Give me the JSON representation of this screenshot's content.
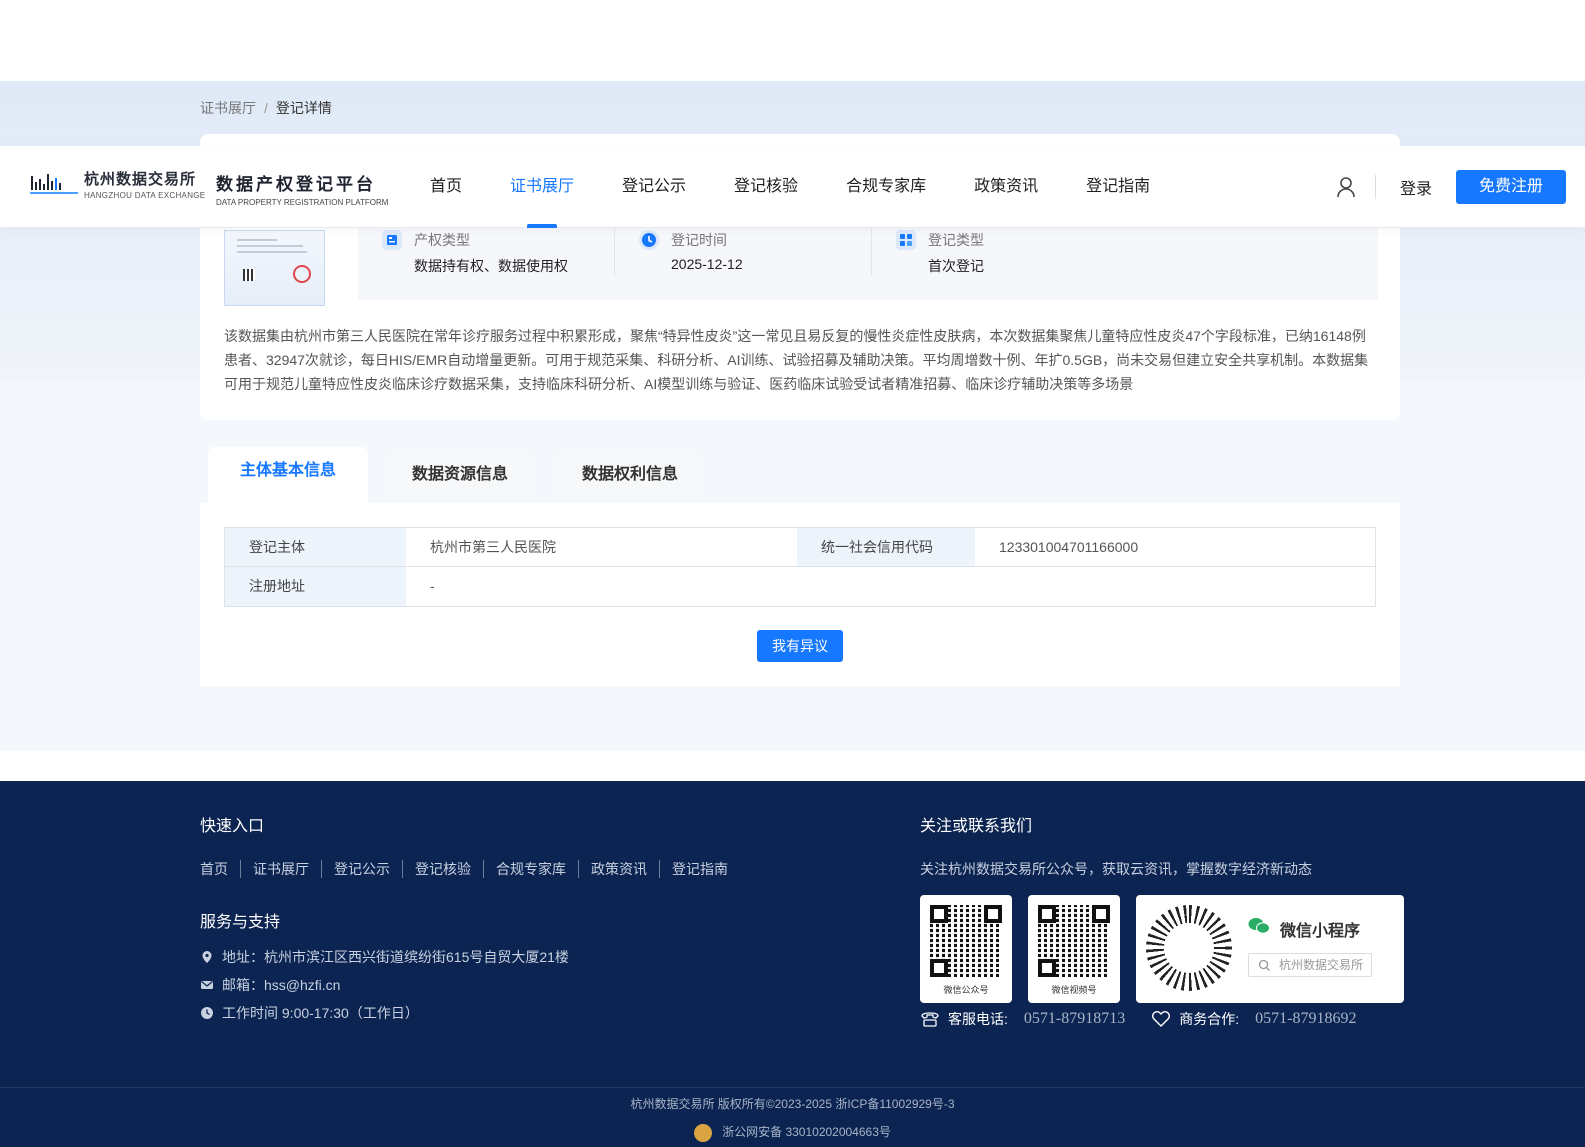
{
  "breadcrumb": {
    "items": [
      "证书展厅",
      "登记详情"
    ],
    "separator": "/"
  },
  "header": {
    "logo": {
      "cn": "杭州数据交易所",
      "en": "HANGZHOU DATA EXCHANGE"
    },
    "platform": {
      "cn": "数据产权登记平台",
      "en": "DATA PROPERTY REGISTRATION PLATFORM"
    },
    "nav": [
      "首页",
      "证书展厅",
      "登记公示",
      "登记核验",
      "合规专家库",
      "政策资讯",
      "登记指南"
    ],
    "active_nav": "证书展厅",
    "login": "登录",
    "register": "免费注册",
    "accent": "#1677ff"
  },
  "summary": {
    "property_type": {
      "label": "产权类型",
      "value": "数据持有权、数据使用权"
    },
    "reg_time": {
      "label": "登记时间",
      "value": "2025-12-12"
    },
    "reg_type": {
      "label": "登记类型",
      "value": "首次登记"
    },
    "description": "该数据集由杭州市第三人民医院在常年诊疗服务过程中积累形成，聚焦“特异性皮炎”这一常见且易反复的慢性炎症性皮肤病，本次数据集聚焦儿童特应性皮炎47个字段标准，已纳16148例患者、32947次就诊，每日HIS/EMR自动增量更新。可用于规范采集、科研分析、AI训练、试验招募及辅助决策。平均周增数十例、年扩0.5GB，尚未交易但建立安全共享机制。本数据集可用于规范儿童特应性皮炎临床诊疗数据采集，支持临床科研分析、AI模型训练与验证、医药临床试验受试者精准招募、临床诊疗辅助决策等多场景"
  },
  "tabs": [
    "主体基本信息",
    "数据资源信息",
    "数据权利信息"
  ],
  "subject": {
    "entity_label": "登记主体",
    "entity_value": "杭州市第三人民医院",
    "credit_label": "统一社会信用代码",
    "credit_value": "123301004701166000",
    "address_label": "注册地址",
    "address_value": "-",
    "objection_button": "我有异议"
  },
  "footer": {
    "quick_title": "快速入口",
    "quick_links": [
      "首页",
      "证书展厅",
      "登记公示",
      "登记核验",
      "合规专家库",
      "政策资讯",
      "登记指南"
    ],
    "service_title": "服务与支持",
    "address": "地址：杭州市滨江区西兴街道缤纷街615号自贸大厦21楼",
    "email": "邮箱：hss@hzfi.cn",
    "hours": "工作时间 9:00-17:30（工作日）",
    "follow_title": "关注或联系我们",
    "follow_desc": "关注杭州数据交易所公众号，获取云资讯，掌握数字经济新动态",
    "qr1_caption": "微信公众号",
    "qr2_caption": "微信视频号",
    "mini_program_title": "微信小程序",
    "mini_program_search": "杭州数据交易所",
    "service_phone_label": "客服电话:",
    "service_phone": "0571-87918713",
    "biz_phone_label": "商务合作:",
    "biz_phone": "0571-87918692",
    "copyright": "杭州数据交易所 版权所有©2023-2025 浙ICP备11002929号-3",
    "beian": "浙公网安备 33010202004663号"
  }
}
